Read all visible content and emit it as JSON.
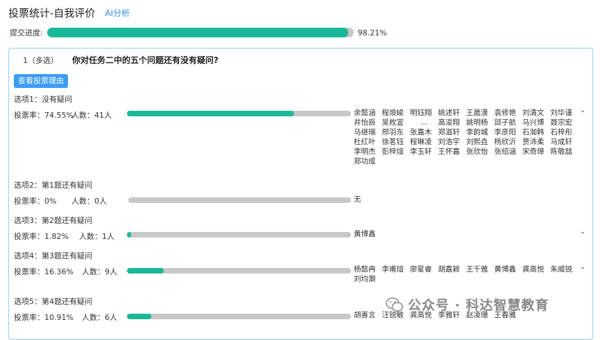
{
  "header": {
    "title": "投票统计-自我评价",
    "ai_link": "AI分析"
  },
  "submit_progress": {
    "label": "提交进度:",
    "percent_text": "98.21%",
    "fraction": 0.9821
  },
  "question": {
    "number_label": "1（多选）",
    "text": "你对任务二中的五个问题还有没有疑问?",
    "view_reason_button": "查看投票理由",
    "options": [
      {
        "title": "选项1：没有疑问",
        "rate_text": "投票率：74.55%",
        "count_text": "人数：41人",
        "fraction": 0.7455,
        "voters": [
          "余懿涵",
          "程烺峻",
          "明钰翔",
          "姚述轩",
          "王晨漠",
          "袁修艳",
          "刘清文",
          "刘华谨",
          "井怡辰",
          "吴枚宣",
          "…",
          "高浚翔",
          "姚明杨",
          "邱子航",
          "马兴博",
          "聂宗宏",
          "马继瑞",
          "邢羽东",
          "张嘉木",
          "郑滋轩",
          "李韵城",
          "李彦阳",
          "石洳韩",
          "石梓彤",
          "杜红叶",
          "徐茗钰",
          "程琳凌",
          "刘浩宇",
          "刘熙垚",
          "杨欣沂",
          "贾沛柔",
          "马成轩",
          "李明杰",
          "彭梓煊",
          "李玉轩",
          "王怀嘉",
          "张欣怡",
          "张绍涵",
          "宋奇璋",
          "陈敬喆",
          "郑功成"
        ]
      },
      {
        "title": "选项2：第1题还有疑问",
        "rate_text": "投票率：0%",
        "count_text": "人数：0人",
        "fraction": 0,
        "voters": [
          "无"
        ]
      },
      {
        "title": "选项3：第2题还有疑问",
        "rate_text": "投票率：1.82%",
        "count_text": "人数：1人",
        "fraction": 0.0182,
        "voters": [
          "黄博鑫"
        ]
      },
      {
        "title": "选项4：第3题还有疑问",
        "rate_text": "投票率：16.36%",
        "count_text": "人数：9人",
        "fraction": 0.1636,
        "voters": [
          "杨懿冉",
          "李甫煊",
          "廖星睿",
          "胡嘉颖",
          "王千雅",
          "黄博鑫",
          "龚高悦",
          "朱威锐",
          "刘均灏"
        ]
      },
      {
        "title": "选项5：第4题还有疑问",
        "rate_text": "投票率：10.91%",
        "count_text": "人数：6人",
        "fraction": 0.1091,
        "voters": [
          "胡善言",
          "汪锐敏",
          "龚高悦",
          "李雅轩",
          "赵凌珊",
          "王春雅"
        ]
      }
    ]
  },
  "watermark": {
    "text": "公众号 · 科达智慧教育"
  },
  "colors": {
    "accent": "#19b997",
    "track": "#c8c8c8",
    "button": "#3a9cf5",
    "link": "#2d8cf0"
  },
  "icons": {
    "collapse": "chevron-up-icon",
    "watermark": "wechat-icon"
  }
}
